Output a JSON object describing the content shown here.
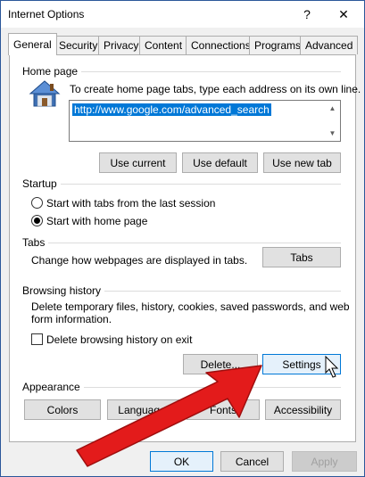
{
  "window": {
    "title": "Internet Options",
    "help_label": "?",
    "close_label": "✕"
  },
  "tabs": [
    {
      "label": "General",
      "active": true
    },
    {
      "label": "Security"
    },
    {
      "label": "Privacy"
    },
    {
      "label": "Content"
    },
    {
      "label": "Connections"
    },
    {
      "label": "Programs"
    },
    {
      "label": "Advanced"
    }
  ],
  "home_page": {
    "group_label": "Home page",
    "description": "To create home page tabs, type each address on its own line.",
    "url": "http://www.google.com/advanced_search",
    "buttons": {
      "use_current": "Use current",
      "use_default": "Use default",
      "use_new_tab": "Use new tab"
    }
  },
  "startup": {
    "group_label": "Startup",
    "option1": "Start with tabs from the last session",
    "option2": "Start with home page",
    "selected": "option2"
  },
  "tabs_section": {
    "group_label": "Tabs",
    "description": "Change how webpages are displayed in tabs.",
    "button": "Tabs"
  },
  "browsing_history": {
    "group_label": "Browsing history",
    "description_line1": "Delete temporary files, history, cookies, saved passwords, and web",
    "description_line2": "form information.",
    "checkbox_label": "Delete browsing history on exit",
    "checkbox_checked": false,
    "delete_button": "Delete...",
    "settings_button": "Settings"
  },
  "appearance": {
    "group_label": "Appearance",
    "colors": "Colors",
    "languages": "Languages",
    "fonts": "Fonts",
    "accessibility": "Accessibility"
  },
  "footer": {
    "ok": "OK",
    "cancel": "Cancel",
    "apply": "Apply"
  },
  "colors": {
    "accent": "#0078d7",
    "annotation_arrow": "#e31b1b"
  }
}
